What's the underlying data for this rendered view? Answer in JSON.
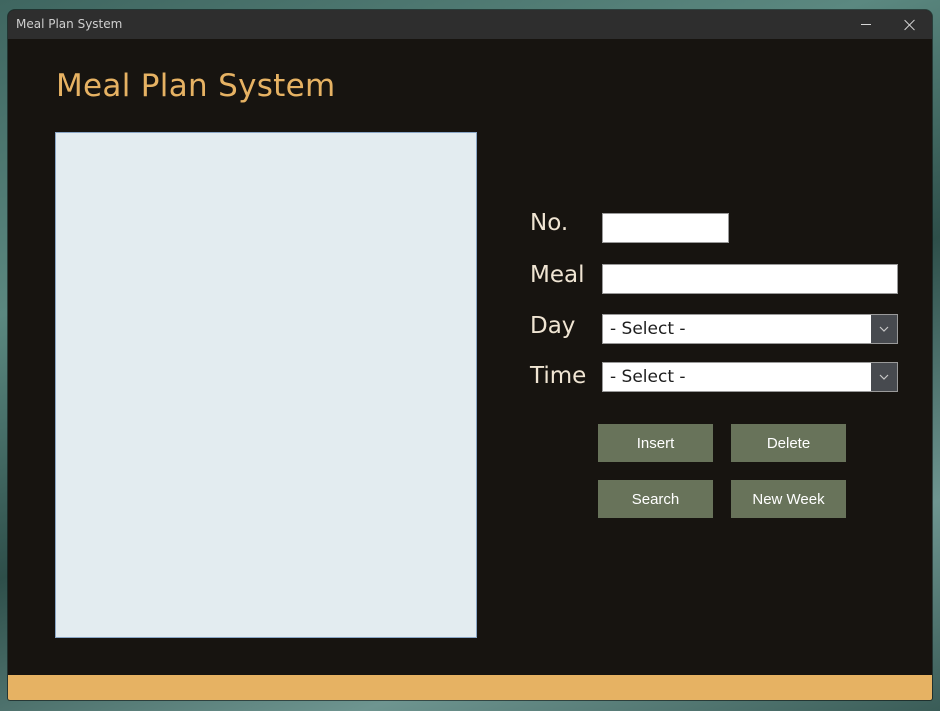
{
  "window": {
    "title": "Meal Plan System"
  },
  "header": {
    "title": "Meal Plan System"
  },
  "form": {
    "no_label": "No.",
    "no_value": "",
    "meal_label": "Meal",
    "meal_value": "",
    "day_label": "Day",
    "day_selected": "- Select -",
    "time_label": "Time",
    "time_selected": "- Select -"
  },
  "buttons": {
    "insert": "Insert",
    "delete": "Delete",
    "search": "Search",
    "new_week": "New Week"
  },
  "icons": {
    "minimize": "minimize-icon",
    "close": "close-icon",
    "dropdown": "chevron-down-icon"
  },
  "colors": {
    "background": "#171410",
    "accent": "#e6b263",
    "button": "#68735a",
    "label_text": "#f0e5d3",
    "list_panel": "#e3ecf0"
  }
}
